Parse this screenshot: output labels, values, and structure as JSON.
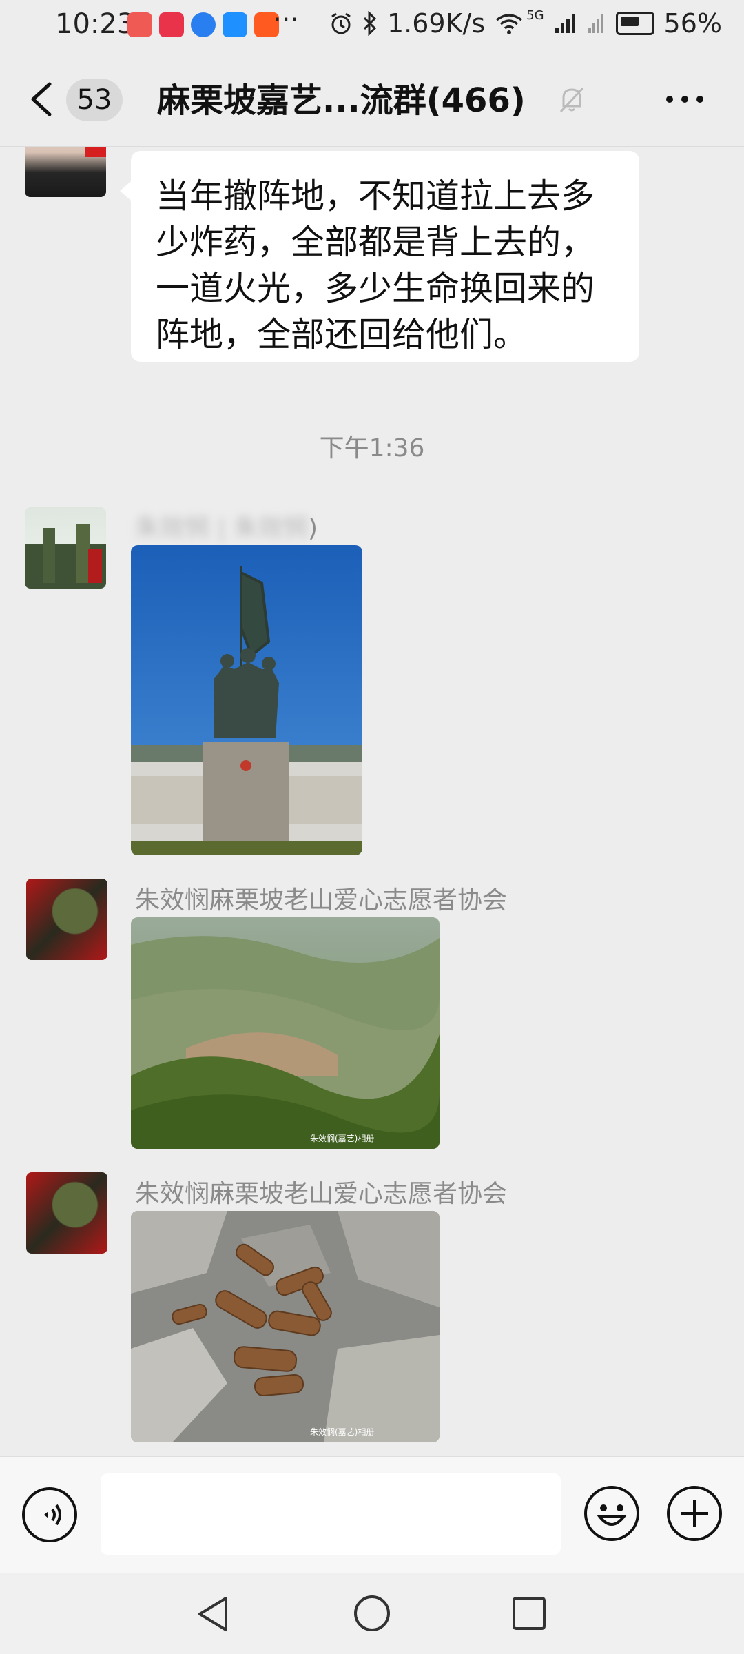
{
  "status_bar": {
    "time": "10:23",
    "dots": "···",
    "speed": "1.69K/s",
    "network": "5G",
    "battery": "56%"
  },
  "header": {
    "unread_count": "53",
    "title": "麻栗坡嘉艺...流群(466)"
  },
  "messages": [
    {
      "type": "text",
      "text": "当年撤阵地，不知道拉上去多少炸药，全部都是背上去的，一道火光，多少生命换回来的阵地，全部还回给他们。"
    },
    {
      "type": "time",
      "text": "下午1:36"
    },
    {
      "type": "image",
      "sender": "朱效悯 | 朱效悯",
      "sender_suffix": ")",
      "image_name": "monument-photo"
    },
    {
      "type": "image",
      "sender": "朱效悯麻栗坡老山爱心志愿者协会",
      "image_name": "mountain-photo",
      "watermark": "朱效悯(嘉艺)相册"
    },
    {
      "type": "image",
      "sender": "朱效悯麻栗坡老山爱心志愿者协会",
      "image_name": "shells-photo",
      "watermark": "朱效悯(嘉艺)相册"
    }
  ],
  "input": {
    "value": "",
    "voice_icon": "voice-icon",
    "emoji_icon": "emoji-icon",
    "plus_icon": "plus-icon"
  },
  "colors": {
    "background": "#ededed",
    "bubble": "#ffffff",
    "muted_text": "#8a8a8a"
  }
}
